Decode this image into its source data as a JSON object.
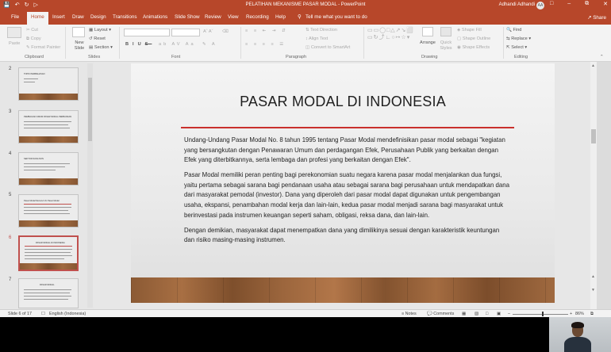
{
  "window": {
    "title": "PELATIHAN MEKANISME PASAR MODAL  -  PowerPoint",
    "user_name": "Adhandi Adhandi",
    "user_initials": "AA"
  },
  "ribbon_tabs": [
    "File",
    "Home",
    "Insert",
    "Draw",
    "Design",
    "Transitions",
    "Animations",
    "Slide Show",
    "Review",
    "View",
    "Recording",
    "Help"
  ],
  "tell_me": "Tell me what you want to do",
  "share_label": "Share",
  "ribbon": {
    "clipboard": {
      "paste": "Paste",
      "cut": "Cut",
      "copy": "Copy",
      "format_painter": "Format Painter",
      "label": "Clipboard"
    },
    "slides": {
      "new_slide": "New Slide",
      "layout": "Layout",
      "reset": "Reset",
      "section": "Section",
      "label": "Slides"
    },
    "font": {
      "label": "Font"
    },
    "paragraph": {
      "text_direction": "Text Direction",
      "align_text": "Align Text",
      "convert_smartart": "Convert to SmartArt",
      "label": "Paragraph"
    },
    "drawing": {
      "arrange": "Arrange",
      "quick_styles": "Quick Styles",
      "shape_fill": "Shape Fill",
      "shape_outline": "Shape Outline",
      "shape_effects": "Shape Effects",
      "label": "Drawing"
    },
    "editing": {
      "find": "Find",
      "replace": "Replace",
      "select": "Select",
      "label": "Editing"
    }
  },
  "thumbnails": [
    {
      "number": "2",
      "title": "TOPIK PEMBAHASAN"
    },
    {
      "number": "3",
      "title": "PEMBAGIAN UMUM PASAR MODAL PERBANKAN"
    },
    {
      "number": "4",
      "title": "SEKTOR DANA NON"
    },
    {
      "number": "5",
      "title": "Pasar Modal Menurut UU Pasar Modal"
    },
    {
      "number": "6",
      "title": "PASAR MODAL DI INDONESIA"
    },
    {
      "number": "7",
      "title": "PASAR MODAL"
    }
  ],
  "slide": {
    "title": "PASAR MODAL DI INDONESIA",
    "paragraphs": [
      "Undang-Undang Pasar Modal No. 8 tahun 1995 tentang Pasar Modal mendefinisikan pasar modal sebagai \"kegiatan yang bersangkutan dengan Penawaran Umum dan perdagangan Efek, Perusahaan Publik yang berkaitan dengan Efek yang diterbitkannya, serta lembaga dan profesi yang berkaitan dengan Efek\".",
      "Pasar Modal memiliki peran penting bagi perekonomian suatu negara karena pasar modal menjalankan dua fungsi, yaitu pertama sebagai sarana bagi pendanaan usaha atau sebagai sarana bagi perusahaan untuk mendapatkan dana dari masyarakat pemodal (investor). Dana yang diperoleh dari pasar modal dapat digunakan untuk pengembangan usaha, ekspansi, penambahan modal kerja dan lain-lain, kedua pasar modal menjadi sarana bagi masyarakat untuk berinvestasi pada instrumen keuangan seperti saham, obligasi, reksa dana, dan lain-lain.",
      "Dengan demikian, masyarakat dapat menempatkan dana yang dimilikinya sesuai dengan karakteristik keuntungan dan risiko masing-masing instrumen."
    ]
  },
  "status": {
    "slide_counter": "Slide 6 of 17",
    "language": "English (Indonesia)",
    "notes": "Notes",
    "comments": "Comments",
    "zoom": "86%"
  },
  "colors": {
    "accent": "#b7472a",
    "title_rule": "#c9302c",
    "selected_thumb": "#c0504d"
  }
}
